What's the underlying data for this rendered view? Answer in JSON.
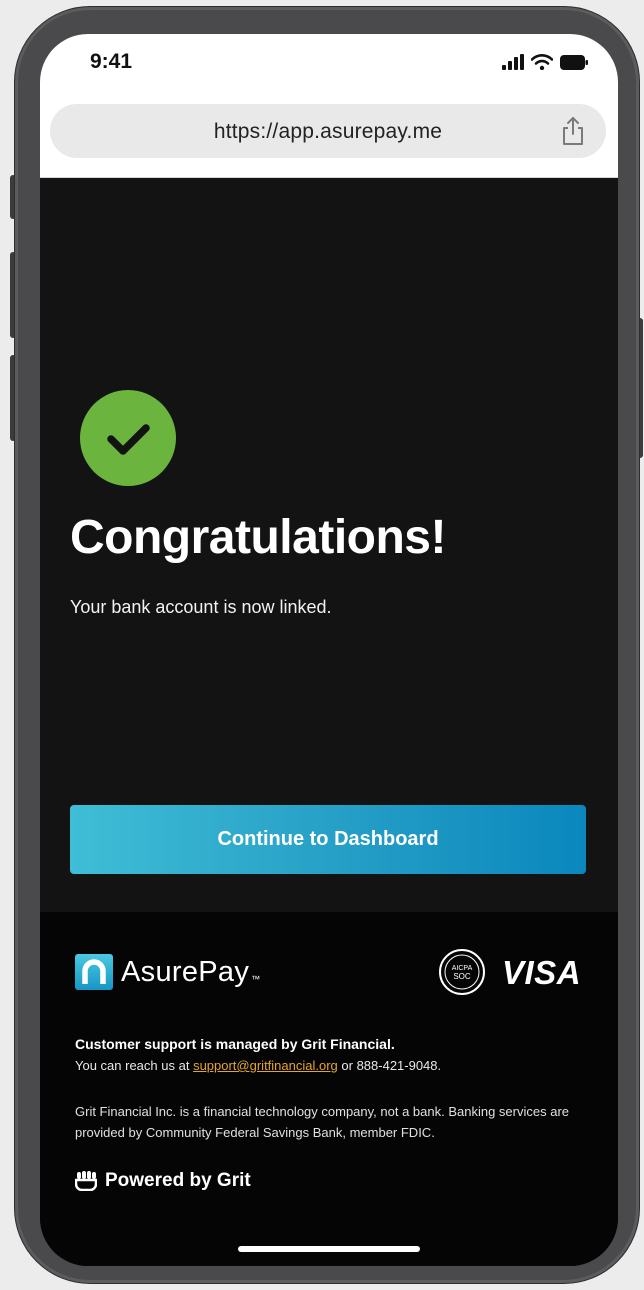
{
  "status_bar": {
    "time": "9:41"
  },
  "browser": {
    "url": "https://app.asurepay.me"
  },
  "main": {
    "headline": "Congratulations!",
    "message": "Your bank account is now linked.",
    "cta_label": "Continue to Dashboard"
  },
  "footer": {
    "brand_name": "AsurePay",
    "brand_tm": "™",
    "badge_text_1": "AICPA",
    "badge_text_2": "SOC",
    "visa_label": "VISA",
    "support_title": "Customer support is managed by Grit Financial.",
    "support_prefix": "You can reach us at ",
    "support_email": "support@gritfinancial.org",
    "support_suffix": " or 888-421-9048.",
    "disclaimer": "Grit Financial Inc. is a financial technology company, not a bank. Banking services are provided by Community Federal Savings Bank, member FDIC.",
    "powered_by": "Powered by Grit"
  },
  "colors": {
    "success_green": "#6bb53f",
    "cta_gradient_start": "#3fbed6",
    "cta_gradient_end": "#0a87bd",
    "link": "#e3a62c",
    "background": "#131314",
    "footer_background": "#050505"
  },
  "icons": {
    "signal": "signal-icon",
    "wifi": "wifi-icon",
    "battery": "battery-icon",
    "share": "share-icon",
    "success": "checkmark-icon",
    "brand": "asurepay-logo-icon",
    "grit": "grit-fist-icon"
  }
}
